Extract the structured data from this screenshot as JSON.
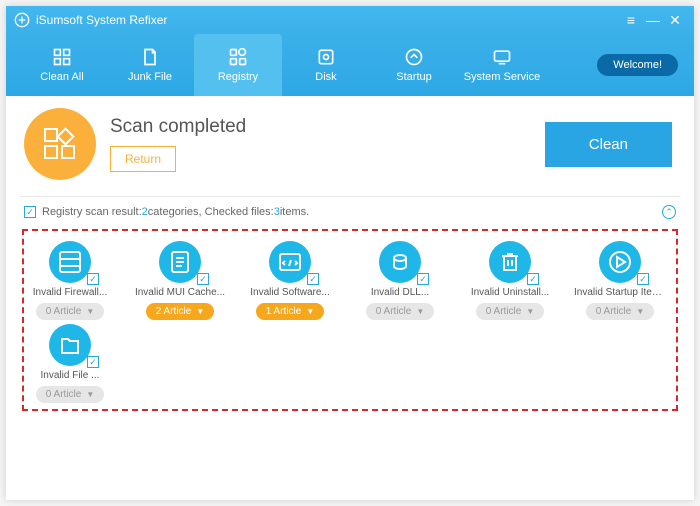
{
  "app": {
    "title": "iSumsoft System Refixer"
  },
  "nav": {
    "items": [
      {
        "label": "Clean All"
      },
      {
        "label": "Junk File"
      },
      {
        "label": "Registry"
      },
      {
        "label": "Disk"
      },
      {
        "label": "Startup"
      },
      {
        "label": "System Service"
      }
    ],
    "welcome": "Welcome!"
  },
  "header": {
    "title": "Scan completed",
    "return": "Return",
    "clean": "Clean"
  },
  "result": {
    "prefix": "Registry scan result: ",
    "cat_num": "2",
    "cat_suffix": " categories, Checked files: ",
    "items_num": "3",
    "items_suffix": " items."
  },
  "cards": [
    {
      "label": "Invalid Firewall...",
      "count": "0 Article",
      "style": "gray"
    },
    {
      "label": "Invalid MUI Cache...",
      "count": "2 Article",
      "style": "orange"
    },
    {
      "label": "Invalid Software...",
      "count": "1 Article",
      "style": "orange"
    },
    {
      "label": "Invalid DLL...",
      "count": "0 Article",
      "style": "gray"
    },
    {
      "label": "Invalid Uninstall...",
      "count": "0 Article",
      "style": "gray"
    },
    {
      "label": "Invalid Startup Item...",
      "count": "0 Article",
      "style": "gray"
    },
    {
      "label": "Invalid File ...",
      "count": "0 Article",
      "style": "gray"
    }
  ]
}
